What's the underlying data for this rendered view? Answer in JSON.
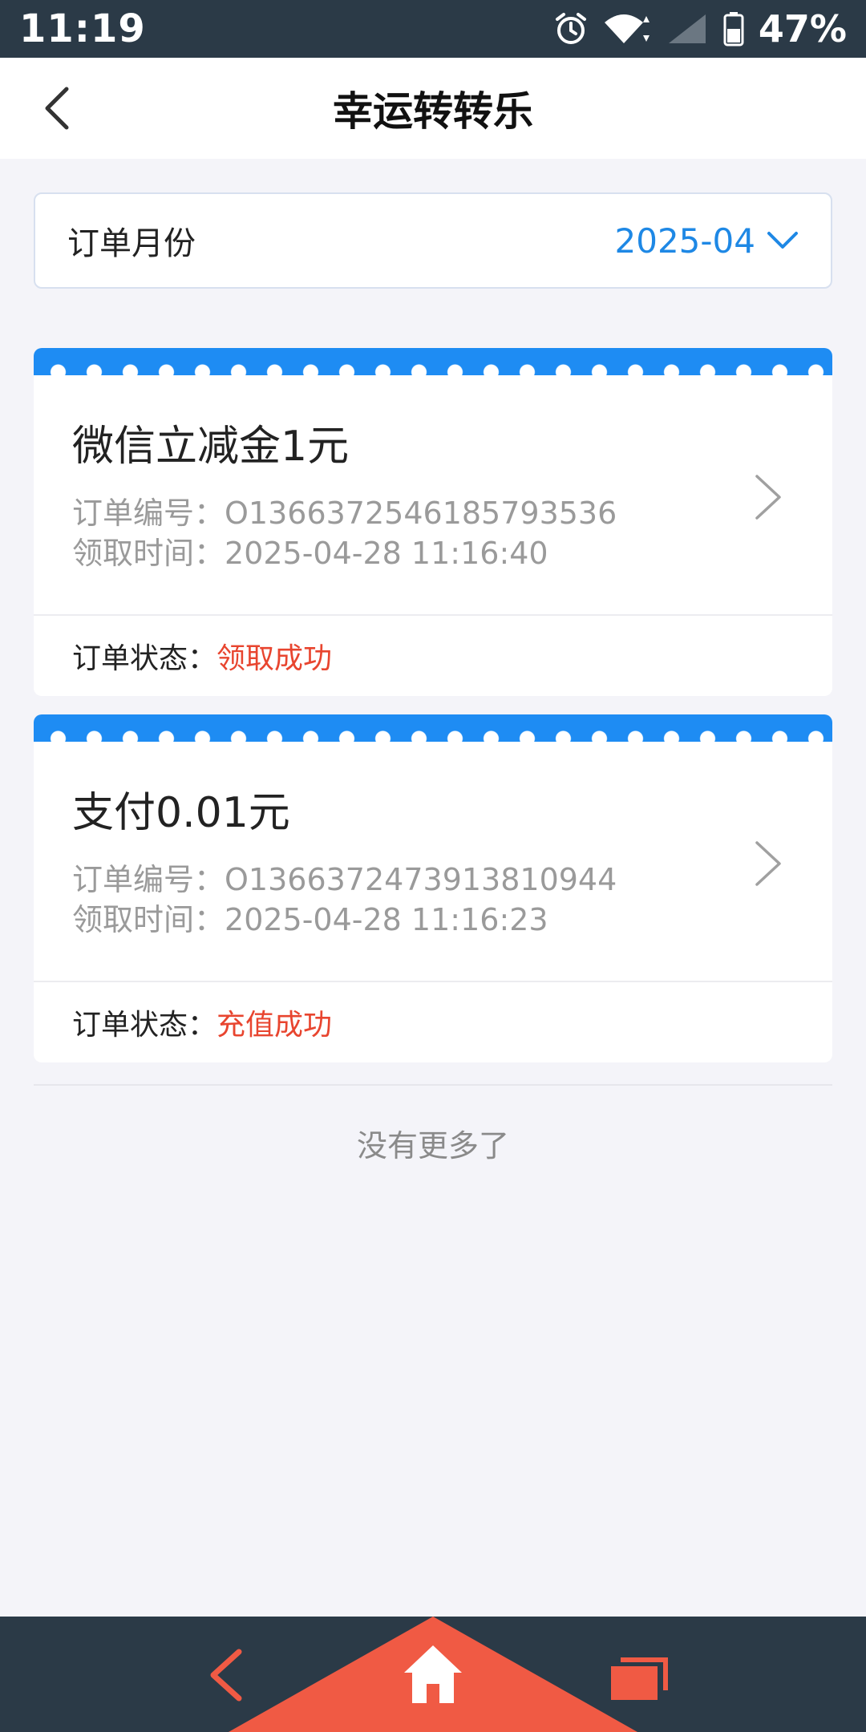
{
  "status_bar": {
    "time": "11:19",
    "battery": "47%"
  },
  "header": {
    "title": "幸运转转乐",
    "back_icon": "chevron-left-icon"
  },
  "month_filter": {
    "label": "订单月份",
    "value": "2025-04"
  },
  "orders": [
    {
      "title": "微信立减金1元",
      "order_no_label": "订单编号：",
      "order_no": "O1366372546185793536",
      "time_label": "领取时间：",
      "time": "2025-04-28 11:16:40",
      "status_label": "订单状态：",
      "status": "领取成功"
    },
    {
      "title": "支付0.01元",
      "order_no_label": "订单编号：",
      "order_no": "O1366372473913810944",
      "time_label": "领取时间：",
      "time": "2025-04-28 11:16:23",
      "status_label": "订单状态：",
      "status": "充值成功"
    }
  ],
  "no_more": "没有更多了",
  "colors": {
    "accent": "#1e88e5",
    "status": "#e8452f",
    "nav_bg": "#2b3a47",
    "nav_home": "#f05a44"
  }
}
